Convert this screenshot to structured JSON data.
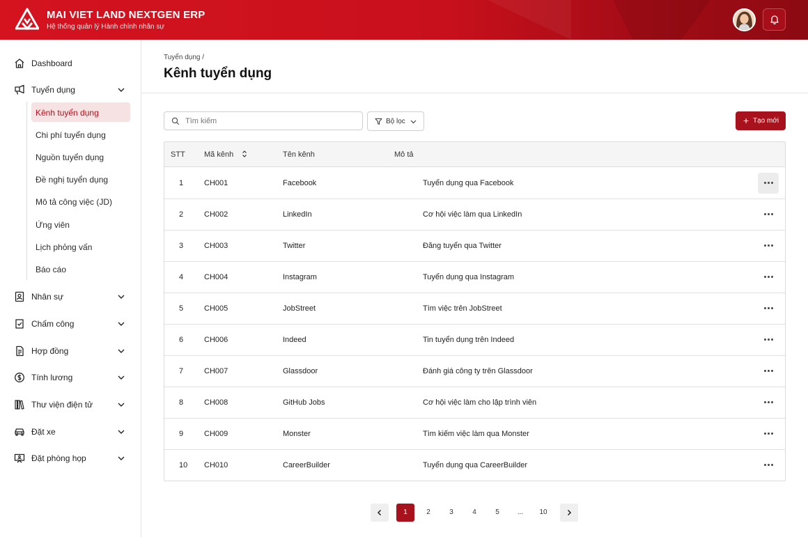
{
  "header": {
    "title": "MAI VIET LAND NEXTGEN ERP",
    "subtitle": "Hệ thống quản lý Hành chính nhân sự",
    "logo_icon": "mai-viet-land-logo",
    "avatar_icon": "user-avatar",
    "bell_icon": "bell-icon",
    "brand_color": "#c8101c"
  },
  "sidebar": {
    "dashboard": "Dashboard",
    "recruitment": {
      "label": "Tuyển dụng",
      "subitems": [
        "Kênh tuyển dụng",
        "Chi phí tuyển dụng",
        "Nguồn tuyển dụng",
        "Đề nghị tuyển dụng",
        "Mô tả công việc (JD)",
        "Ứng viên",
        "Lịch phỏng vấn",
        "Báo cáo"
      ],
      "active_index": 0
    },
    "sections": [
      "Nhân sự",
      "Chấm công",
      "Hợp đồng",
      "Tính lương",
      "Thư viện điện tử",
      "Đặt xe",
      "Đặt phòng họp"
    ]
  },
  "main": {
    "breadcrumb": "Tuyển dụng /",
    "title": "Kênh tuyển dụng",
    "search_placeholder": "Tìm kiếm",
    "filter_label": "Bộ lọc",
    "create_label": "Tạo mới",
    "accent_color": "#a8121c"
  },
  "table": {
    "headers": [
      "STT",
      "Mã kênh",
      "Tên kênh",
      "Mô tả"
    ],
    "rows": [
      {
        "stt": "1",
        "code": "CH001",
        "name": "Facebook",
        "desc": "Tuyển dụng qua Facebook"
      },
      {
        "stt": "2",
        "code": "CH002",
        "name": "LinkedIn",
        "desc": "Cơ hội việc làm qua LinkedIn"
      },
      {
        "stt": "3",
        "code": "CH003",
        "name": "Twitter",
        "desc": "Đăng tuyển qua Twitter"
      },
      {
        "stt": "4",
        "code": "CH004",
        "name": "Instagram",
        "desc": "Tuyển dụng qua Instagram"
      },
      {
        "stt": "5",
        "code": "CH005",
        "name": "JobStreet",
        "desc": "Tìm việc trên JobStreet"
      },
      {
        "stt": "6",
        "code": "CH006",
        "name": "Indeed",
        "desc": "Tin tuyển dụng trên Indeed"
      },
      {
        "stt": "7",
        "code": "CH007",
        "name": "Glassdoor",
        "desc": "Đánh giá công ty trên Glassdoor"
      },
      {
        "stt": "8",
        "code": "CH008",
        "name": "GitHub Jobs",
        "desc": "Cơ hội việc làm cho lập trình viên"
      },
      {
        "stt": "9",
        "code": "CH009",
        "name": "Monster",
        "desc": "Tìm kiếm việc làm qua Monster"
      },
      {
        "stt": "10",
        "code": "CH010",
        "name": "CareerBuilder",
        "desc": "Tuyển dụng qua CareerBuilder"
      }
    ]
  },
  "pagination": {
    "pages": [
      "1",
      "2",
      "3",
      "4",
      "5",
      "...",
      "10"
    ],
    "current": "1"
  }
}
